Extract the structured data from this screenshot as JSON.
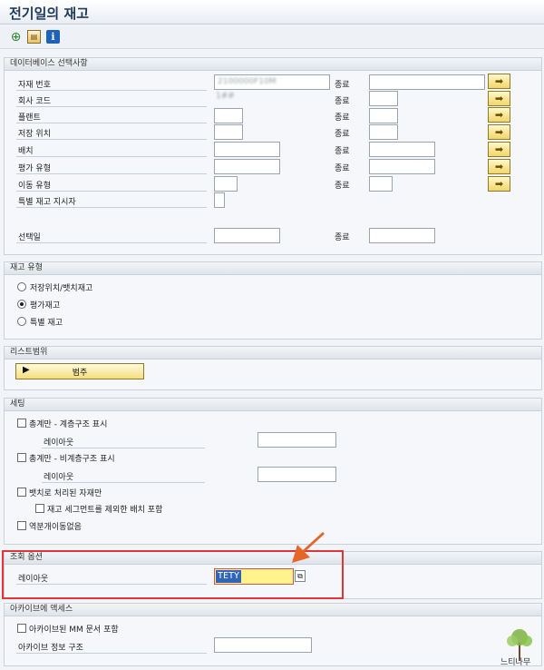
{
  "window": {
    "title": "전기일의 재고"
  },
  "toolbar": {
    "execute_icon": "execute-icon",
    "variant_icon": "get-variant-icon",
    "info_icon": "info-icon",
    "info_glyph": "i"
  },
  "db_selection": {
    "title": "데이터베이스 선택사항",
    "to_label": "종료",
    "rows": [
      {
        "label": "자재 번호",
        "from_value": "",
        "blurred": "2100000F10M"
      },
      {
        "label": "회사 코드",
        "from_value": "",
        "blurred": "1##"
      },
      {
        "label": "플랜트",
        "from_value": ""
      },
      {
        "label": "저장 위치",
        "from_value": ""
      },
      {
        "label": "배치",
        "from_value": ""
      },
      {
        "label": "평가 유형",
        "from_value": ""
      },
      {
        "label": "이동 유형",
        "from_value": ""
      },
      {
        "label": "특별 재고 지시자",
        "from_value": ""
      },
      {
        "label": "선택일",
        "from_value": ""
      }
    ]
  },
  "stock_type": {
    "title": "재고 유형",
    "options": [
      {
        "label": "저장위치/뱃치재고",
        "selected": false
      },
      {
        "label": "평가재고",
        "selected": true
      },
      {
        "label": "특별 재고",
        "selected": false
      }
    ]
  },
  "list_scope": {
    "title": "리스트범위",
    "button_label": "범주"
  },
  "settings": {
    "title": "세팅",
    "totals_hier": "총계만 - 계층구조 표시",
    "layout_label": "레이아웃",
    "totals_nonhier": "총계만 - 비계층구조 표시",
    "batch_managed": "뱃치로 처리된 자재만",
    "incl_segment": "재고 세그먼트를 제외한 배치 포함",
    "no_reverse": "역분개이동없음"
  },
  "display_options": {
    "title": "조회 옵션",
    "layout_label": "레이아웃",
    "layout_value": "TETY"
  },
  "archive": {
    "title": "아카이브에 액세스",
    "include_archived": "아카이브된 MM 문서 포함",
    "info_structure": "아카이브 정보 구조"
  },
  "watermark": {
    "text": "느티나무"
  },
  "colors": {
    "highlight": "#e0363a",
    "arrow": "#e8652a",
    "selected": "#2f65b6",
    "required_bg": "#fff48c"
  }
}
